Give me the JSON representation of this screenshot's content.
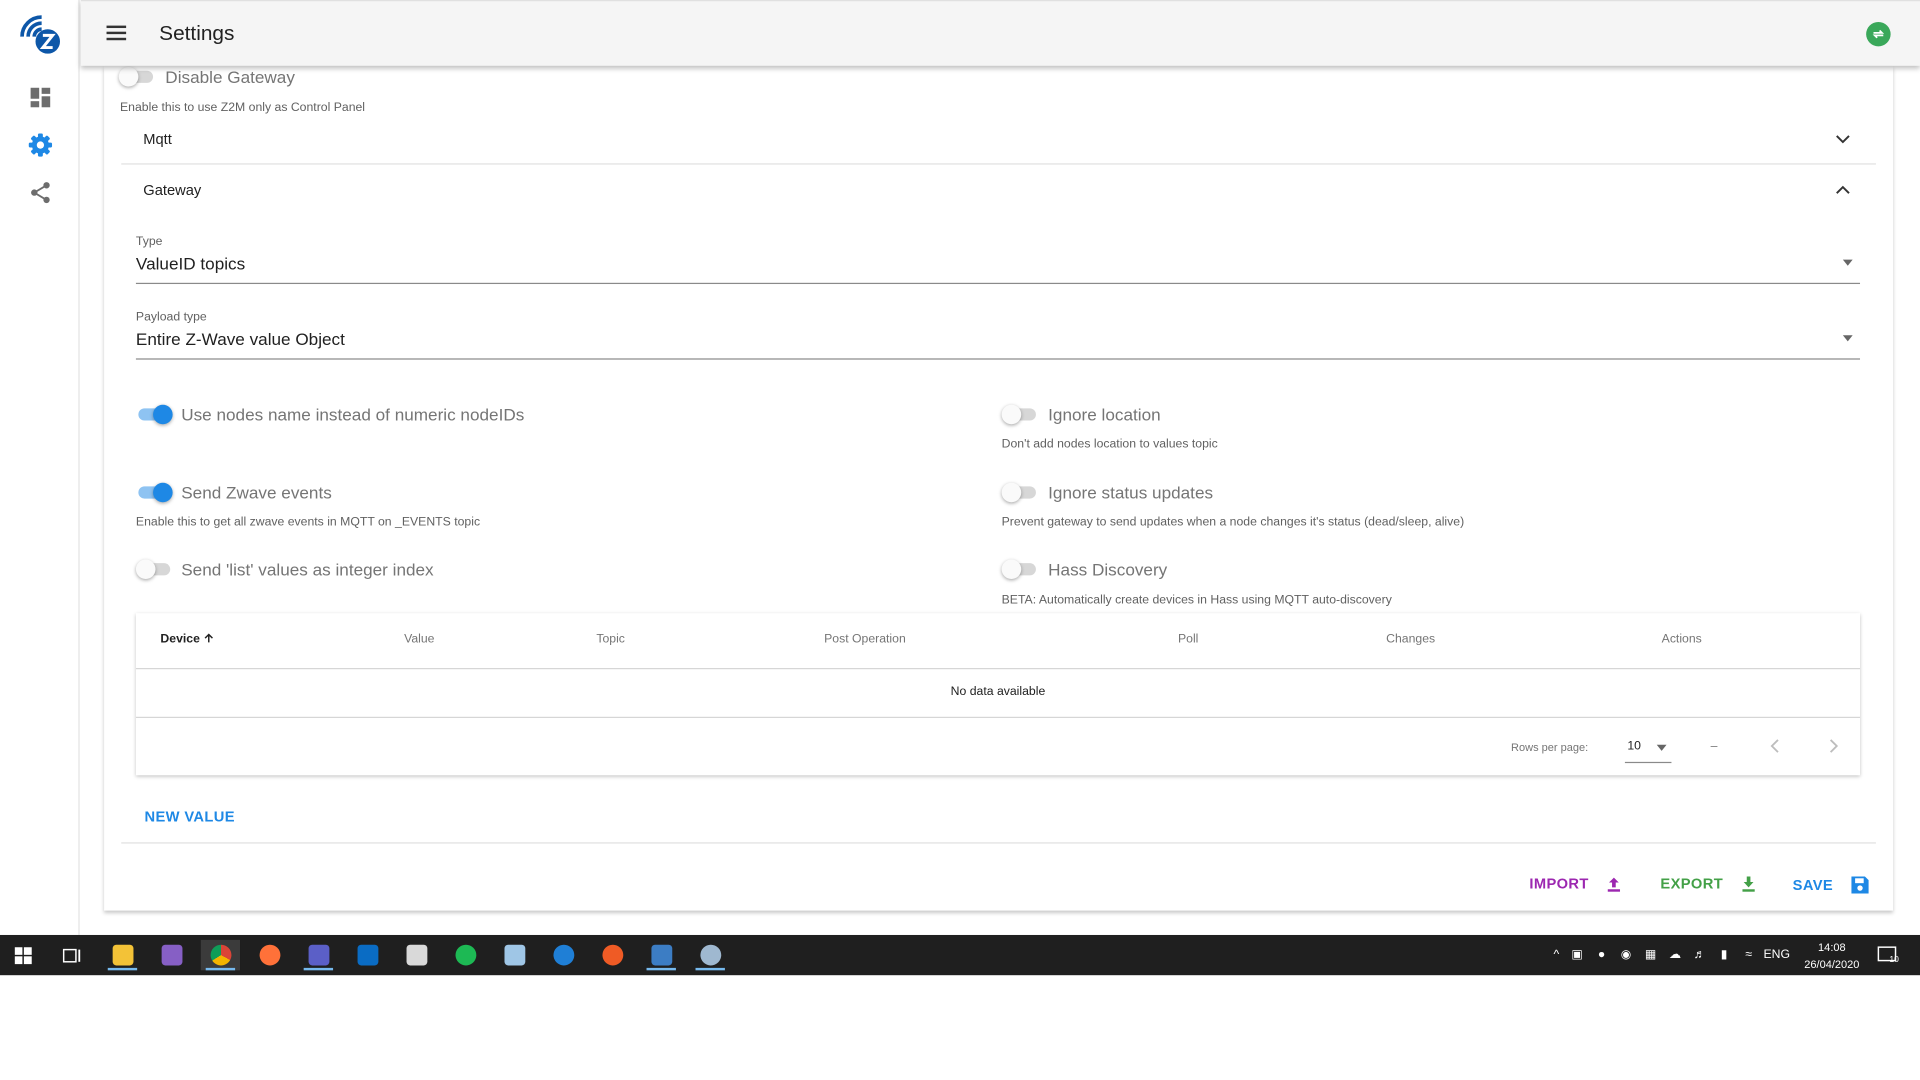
{
  "app": {
    "title": "Settings",
    "brand_color": "#0d57a8",
    "accent": "#1e88e5"
  },
  "sidebar": {
    "items": [
      {
        "name": "dashboard",
        "icon": "dashboard-icon",
        "active": false
      },
      {
        "name": "settings",
        "icon": "gear-icon",
        "active": true
      },
      {
        "name": "network",
        "icon": "share-icon",
        "active": false
      }
    ]
  },
  "settings": {
    "disable_gateway": {
      "label": "Disable Gateway",
      "hint": "Enable this to use Z2M only as Control Panel",
      "checked": false
    },
    "panels": {
      "mqtt": {
        "title": "Mqtt",
        "expanded": false
      },
      "gateway": {
        "title": "Gateway",
        "expanded": true
      }
    },
    "type_select": {
      "label": "Type",
      "value": "ValueID topics"
    },
    "payload_select": {
      "label": "Payload type",
      "value": "Entire Z-Wave value Object"
    },
    "toggles": {
      "use_names": {
        "label": "Use nodes name instead of numeric nodeIDs",
        "hint": "",
        "checked": true
      },
      "ignore_location": {
        "label": "Ignore location",
        "hint": "Don't add nodes location to values topic",
        "checked": false
      },
      "send_events": {
        "label": "Send Zwave events",
        "hint": "Enable this to get all zwave events in MQTT on _EVENTS topic",
        "checked": true
      },
      "ignore_status": {
        "label": "Ignore status updates",
        "hint": "Prevent gateway to send updates when a node changes it's status (dead/sleep, alive)",
        "checked": false
      },
      "list_int": {
        "label": "Send 'list' values as integer index",
        "hint": "",
        "checked": false
      },
      "hass": {
        "label": "Hass Discovery",
        "hint": "BETA: Automatically create devices in Hass using MQTT auto-discovery",
        "checked": false
      }
    },
    "table": {
      "columns": [
        "Device",
        "Value",
        "Topic",
        "Post Operation",
        "Poll",
        "Changes",
        "Actions"
      ],
      "sort_column": "Device",
      "empty_text": "No data available",
      "rows_per_page_label": "Rows per page:",
      "rows_per_page": "10",
      "range": "–"
    },
    "new_value_label": "NEW VALUE",
    "actions": {
      "import": {
        "label": "IMPORT",
        "color": "#9c27b0"
      },
      "export": {
        "label": "EXPORT",
        "color": "#43a047"
      },
      "save": {
        "label": "SAVE",
        "color": "#1e88e5"
      }
    }
  },
  "taskbar": {
    "apps": [
      "start-icon",
      "task-view-icon",
      "file-explorer-icon",
      "visual-studio-icon",
      "chrome-icon",
      "firefox-icon",
      "teams-icon",
      "outlook-icon",
      "snipping-tool-icon",
      "spotify-icon",
      "notepad-icon",
      "edge-icon",
      "postman-icon",
      "vscode-remote-icon",
      "paint-icon"
    ],
    "language": "ENG",
    "time": "14:08",
    "date": "26/04/2020",
    "notifications": "10"
  }
}
